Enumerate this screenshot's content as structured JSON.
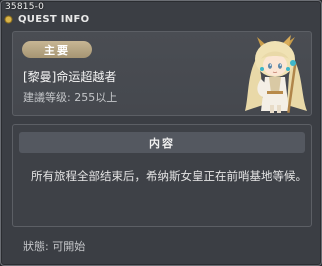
{
  "window": {
    "quest_id": "35815-0",
    "title": "QUEST INFO"
  },
  "quest": {
    "category": "主要",
    "name": "[黎曼]命运超越者",
    "level_requirement": "建議等级: 255以上"
  },
  "content": {
    "header": "内容",
    "description": "所有旅程全部结束后，希纳斯女皇正在前哨基地等候。"
  },
  "status": {
    "text": "狀態:  可開始"
  },
  "colors": {
    "badge": "#b8a683",
    "panel": "#474a50",
    "header_bar": "#545860"
  },
  "icons": {
    "title_icon": "info-dot-icon",
    "npc": "npc-portrait-cygnus"
  }
}
